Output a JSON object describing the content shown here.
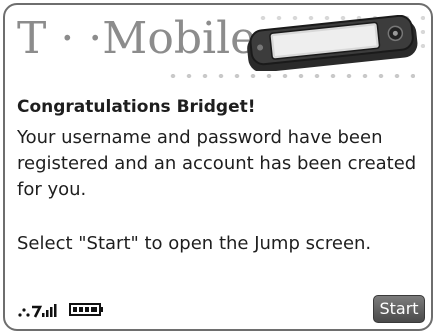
{
  "header": {
    "logo_text": "T · ·Mobile·",
    "device_image_icon": "phone-device-icon"
  },
  "main": {
    "title": "Congratulations Bridget!",
    "message": "Your username and password have been registered and an account has been created for you.",
    "instruction": "Select \"Start\" to open the Jump screen."
  },
  "status_bar": {
    "signal_icon": "signal-strength-icon",
    "battery_icon": "battery-icon"
  },
  "softkey": {
    "start_label": "Start"
  },
  "colors": {
    "frame_border": "#6e6e6e",
    "logo": "#8c8c8c",
    "text": "#1e1e1e",
    "button_bg": "#5a5a5a"
  }
}
